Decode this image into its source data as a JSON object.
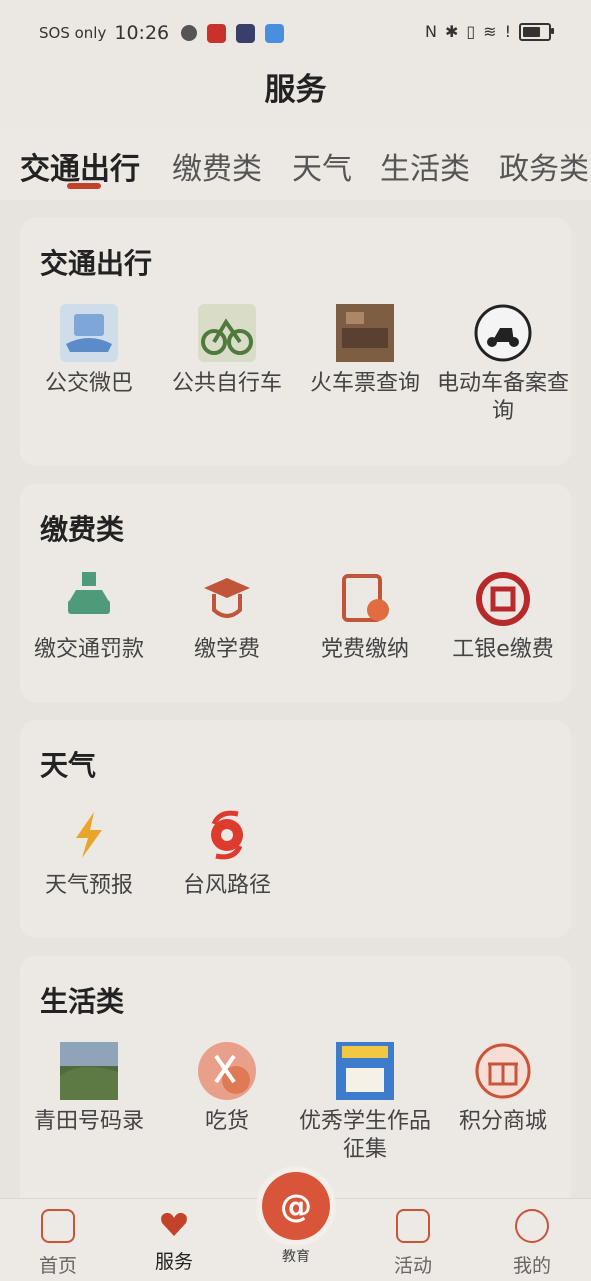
{
  "status": {
    "carrier": "SOS only",
    "time": "10:26"
  },
  "title": "服务",
  "tabs": [
    "交通出行",
    "缴费类",
    "天气",
    "生活类",
    "政务类"
  ],
  "sections": [
    {
      "title": "交通出行",
      "items": [
        "公交微巴",
        "公共自行车",
        "火车票查询",
        "电动车备案查询"
      ]
    },
    {
      "title": "缴费类",
      "items": [
        "缴交通罚款",
        "缴学费",
        "党费缴纳",
        "工银e缴费"
      ]
    },
    {
      "title": "天气",
      "items": [
        "天气预报",
        "台风路径"
      ]
    },
    {
      "title": "生活类",
      "items": [
        "青田号码录",
        "吃货",
        "优秀学生作品征集",
        "积分商城"
      ]
    }
  ],
  "nav": {
    "home": "首页",
    "service": "服务",
    "education": "教育",
    "activity": "活动",
    "mine": "我的"
  },
  "colors": {
    "accent": "#c2432a",
    "background": "#e7e4df"
  }
}
